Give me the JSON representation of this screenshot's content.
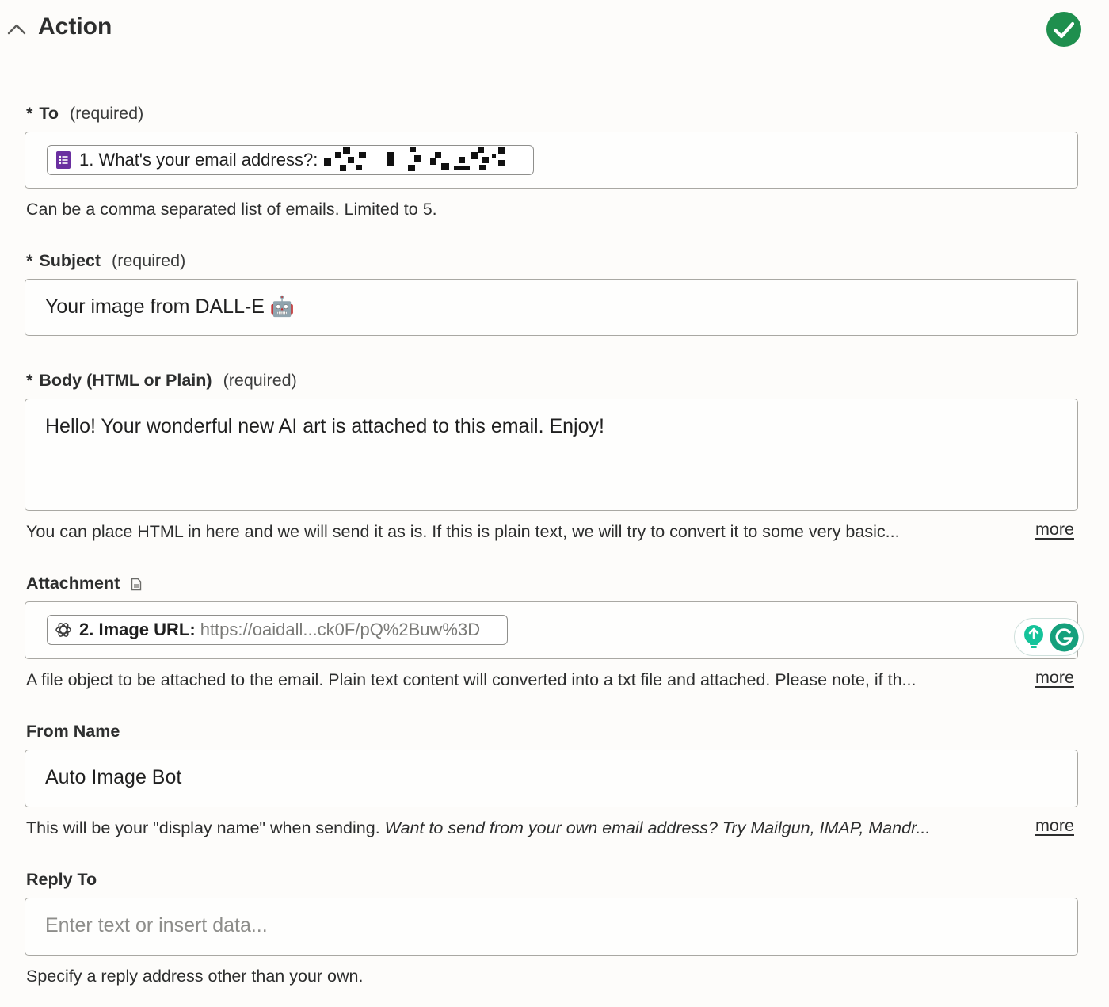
{
  "header": {
    "title": "Action",
    "status_icon": "check-circle-icon",
    "status_color": "#1f8f4e"
  },
  "fields": {
    "to": {
      "star": "*",
      "label": "To",
      "required": "(required)",
      "pill_label": "1. What's your email address?:",
      "pill_icon": "google-forms-icon",
      "help": "Can be a comma separated list of emails. Limited to 5."
    },
    "subject": {
      "star": "*",
      "label": "Subject",
      "required": "(required)",
      "value": "Your image from DALL-E 🤖"
    },
    "body": {
      "star": "*",
      "label": "Body (HTML or Plain)",
      "required": "(required)",
      "value": "Hello! Your wonderful new AI art is attached to this email. Enjoy!",
      "help": "You can place HTML in here and we will send it as is. If this is plain text, we will try to convert it to some very basic...",
      "more": "more"
    },
    "attachment": {
      "label": "Attachment",
      "label_icon": "file-icon",
      "pill_label": "2. Image URL:",
      "pill_value": "https://oaidall...ck0F/pQ%2Buw%3D",
      "pill_icon": "openai-icon",
      "help": "A file object to be attached to the email. Plain text content will converted into a txt file and attached. Please note, if th...",
      "more": "more"
    },
    "from_name": {
      "label": "From Name",
      "value": "Auto Image Bot",
      "help_plain": "This will be your \"display name\" when sending.",
      "help_italic": "Want to send from your own email address? Try Mailgun, IMAP, Mandr...",
      "more": "more"
    },
    "reply_to": {
      "label": "Reply To",
      "placeholder": "Enter text or insert data...",
      "help": "Specify a reply address other than your own."
    }
  },
  "colors": {
    "accent_green": "#1f8f4e",
    "forms_purple": "#6a2fa0",
    "grammarly_green": "#15c39a"
  }
}
